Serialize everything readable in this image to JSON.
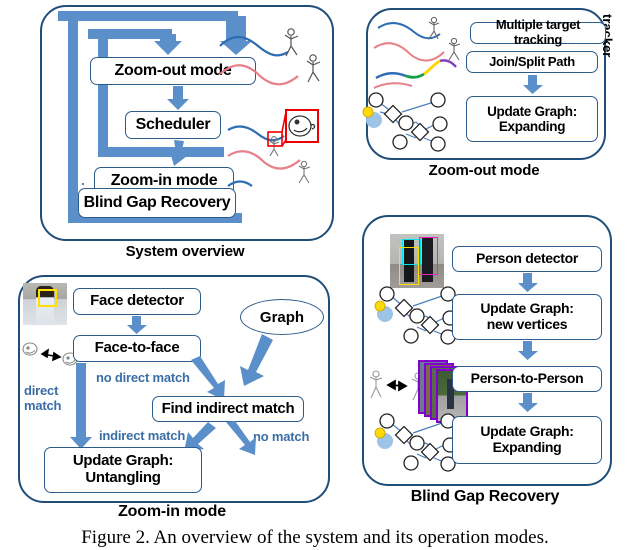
{
  "figure": {
    "caption": "Figure 2. An overview of the system and its operation modes."
  },
  "colors": {
    "panel_border": "#1F4E79",
    "box_border": "#2E5C8A",
    "arrow_blue": "#5B8FC9",
    "label_blue": "#3A6EA5",
    "trajectory_blue": "#2E6DB4",
    "trajectory_red": "#E8808A",
    "highlight_red": "#EE0000",
    "face_box_yellow": "#FFE000",
    "person_box_cyan": "#00E5F0",
    "person_box_magenta": "#F020C0",
    "person_box_yellow": "#FFE000",
    "image_stack_purple": "#8000D0",
    "graph_node_fill": "#FFFFFF",
    "graph_edge": "#4A7EBB",
    "active_vertex": "#9DC3E6",
    "smiley_yellow": "#FFD900"
  },
  "panels": {
    "system_overview": {
      "caption": "System overview",
      "boxes": [
        {
          "label": "Zoom-out mode"
        },
        {
          "label": "Scheduler"
        },
        {
          "label": "Zoom-in mode"
        },
        {
          "label": "Blind Gap Recovery"
        }
      ],
      "art": {
        "trajectories": [
          "blue",
          "red"
        ],
        "figures": [
          "walking-person",
          "walking-person"
        ],
        "magnifier": "red-callout-zoomed-face"
      }
    },
    "zoom_out_mode": {
      "caption": "Zoom-out mode",
      "side_label": "tracker",
      "boxes": [
        {
          "label": "Multiple target tracking"
        },
        {
          "label": "Join/Split Path"
        },
        {
          "line1": "Update Graph:",
          "line2": "Expanding"
        }
      ],
      "art": {
        "trajectories": [
          "blue",
          "red",
          "blue-green-yellow-purple"
        ],
        "graph": "vertices-diamonds-expanding"
      }
    },
    "zoom_in_mode": {
      "caption": "Zoom-in mode",
      "boxes": [
        {
          "label": "Face detector"
        },
        {
          "label": "Face-to-face"
        },
        {
          "label": "Find indirect match"
        },
        {
          "line1": "Update Graph:",
          "line2": "Untangling"
        }
      ],
      "ellipse": {
        "label": "Graph"
      },
      "edge_labels": [
        {
          "line1": "direct",
          "line2": "match"
        },
        {
          "label": "no direct match"
        },
        {
          "label": "indirect match"
        },
        {
          "label": "no match"
        }
      ],
      "art": {
        "photo": "person-with-yellow-face-box",
        "face_pair": "two-faces-double-arrow"
      }
    },
    "blind_gap_recovery": {
      "caption": "Blind Gap Recovery",
      "boxes": [
        {
          "label": "Person detector"
        },
        {
          "line1": "Update Graph:",
          "line2": "new vertices"
        },
        {
          "label": "Person-to-Person"
        },
        {
          "line1": "Update Graph:",
          "line2": "Expanding"
        }
      ],
      "art": {
        "photo": "two-people-with-color-boxes",
        "graph_top": "vertices-diamonds",
        "person_pair": "two-stick-figures-double-arrow",
        "image_stack": "purple-bordered-photo-stack",
        "graph_bottom": "vertices-diamonds"
      }
    }
  }
}
